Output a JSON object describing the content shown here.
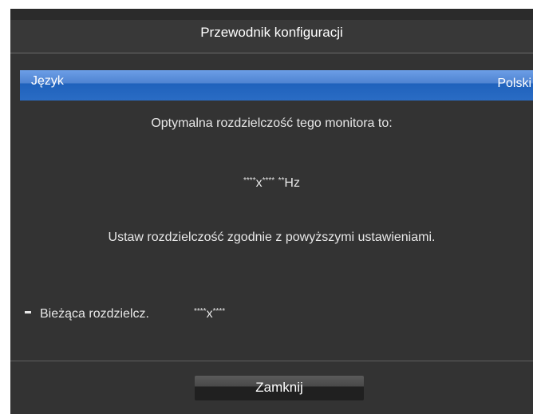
{
  "dialog": {
    "title": "Przewodnik konfiguracji",
    "language_label": "Język",
    "language_value": "Polski",
    "optimal_text": "Optymalna rozdzielczość tego monitora to:",
    "resolution_stars_a": "****",
    "resolution_x": "x",
    "resolution_stars_b": "****",
    "resolution_hz_stars": "**",
    "resolution_hz_unit": "Hz",
    "instruction_text": "Ustaw rozdzielczość zgodnie z powyższymi ustawieniami.",
    "current_label": "Bieżąca rozdzielcz.",
    "current_stars_a": "****",
    "current_x": "x",
    "current_stars_b": "****",
    "close_label": "Zamknij"
  },
  "colors": {
    "background": "#333333",
    "highlight": "#2a6cc4",
    "text": "#e8e8e8"
  }
}
